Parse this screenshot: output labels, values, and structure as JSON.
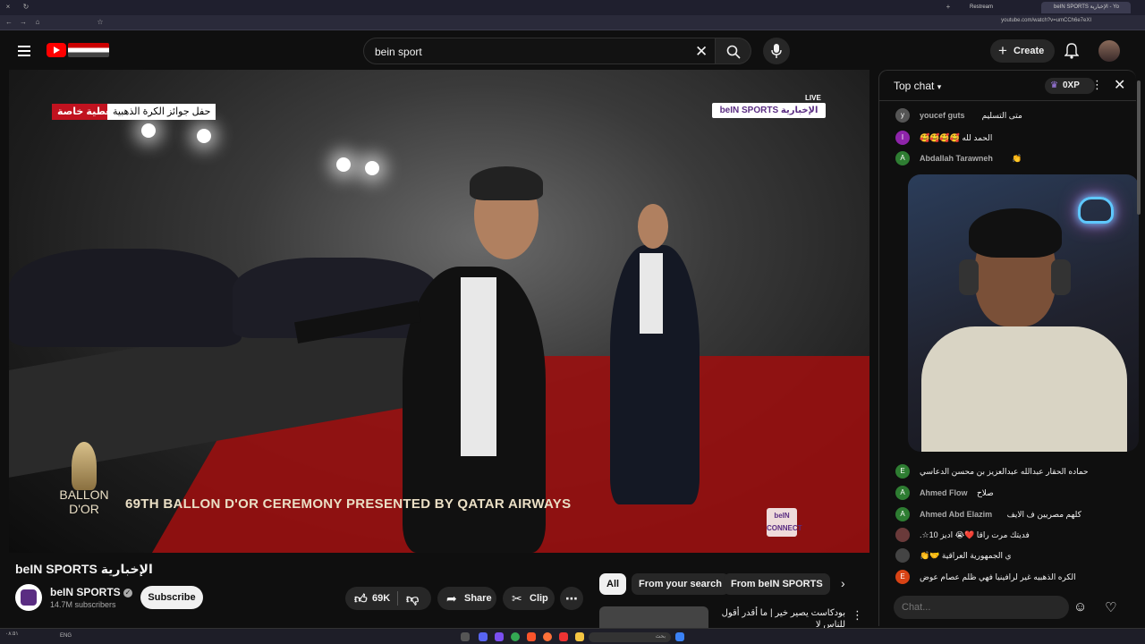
{
  "browser": {
    "tabs": [
      {
        "label": "Restream"
      },
      {
        "label": "beIN SPORTS الإخبارية - Yo"
      }
    ],
    "url": "youtube.com/watch?v=umCCh6e7eXI",
    "close_tab_glyph": "×"
  },
  "header": {
    "search_value": "bein sport",
    "create_label": "Create"
  },
  "video": {
    "tag_red": "تغطية خاصة",
    "tag_white": "حفل جوائز الكرة الذهبية",
    "channel_logo": "beIN SPORTS الإخبارية",
    "live_label": "LIVE",
    "ceremony_text": "69TH BALLON D'OR CEREMONY PRESENTED BY QATAR AIRWAYS",
    "ballon_label": "BALLON D'OR",
    "connect_label": "beIN CONNECT"
  },
  "below": {
    "title": "beIN SPORTS الإخبارية",
    "channel_name": "beIN SPORTS",
    "subscribers": "14.7M subscribers",
    "subscribe_label": "Subscribe",
    "likes": "69K",
    "share_label": "Share",
    "clip_label": "Clip",
    "chips": [
      "All",
      "From your search",
      "From beIN SPORTS"
    ],
    "rec_title": "بودكاست يصير خير | ما أقدر أقول للناس لا"
  },
  "chat": {
    "title": "Top chat",
    "xp": "0XP",
    "input_placeholder": "Chat...",
    "messages": [
      {
        "avatar": "y",
        "author": "youcef guts",
        "text": "متى التسليم",
        "color": "#555"
      },
      {
        "avatar": "I",
        "author": "",
        "text": "الحمد لله 🥰🥰🥰🥰",
        "color": "#8e24aa"
      },
      {
        "avatar": "A",
        "author": "Abdallah Tarawneh",
        "text": "👏",
        "color": "#2e7d32"
      },
      {
        "avatar": "E",
        "author": "",
        "text": "حماده الحقار  عبدالله عبدالعزيز بن محسن الدعاسي",
        "color": "#2e7d32"
      },
      {
        "avatar": "A",
        "author": "Ahmed Flow",
        "text": "صلاح",
        "color": "#2e7d32"
      },
      {
        "avatar": "A",
        "author": "Ahmed Abd Elazim",
        "text": "كلهم مصريين ف الايف",
        "color": "#2e7d32"
      },
      {
        "avatar": "",
        "author": "",
        "text": "فديتك مرت راقا ❤️😭 اديز 10☆.",
        "color": "#6a3a3a"
      },
      {
        "avatar": "",
        "author": "",
        "text": "ي الجمهورية العراقية 🤝👏",
        "color": "#444"
      },
      {
        "avatar": "E",
        "author": "",
        "text": "الكره الذهبيه غير لرافينيا فهي ظلم  عصام عوض",
        "color": "#d84315"
      }
    ]
  },
  "taskbar": {
    "search_placeholder": "بحث",
    "lang": "ENG",
    "time": "٠٨:٥١"
  }
}
